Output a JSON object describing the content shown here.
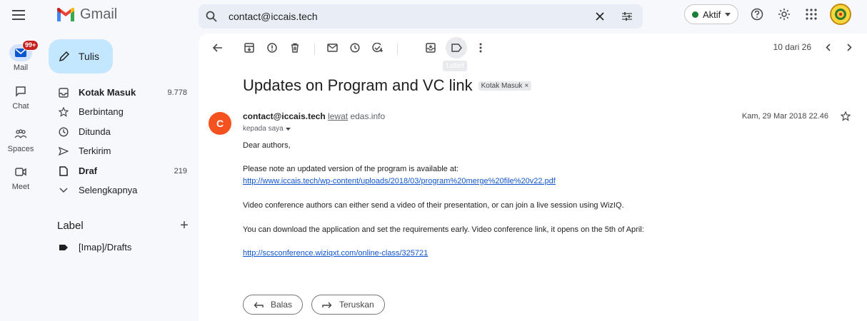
{
  "app": {
    "name": "Gmail"
  },
  "rail": {
    "items": [
      {
        "label": "Mail",
        "badge": "99+"
      },
      {
        "label": "Chat"
      },
      {
        "label": "Spaces"
      },
      {
        "label": "Meet"
      }
    ]
  },
  "sidebar": {
    "compose_label": "Tulis",
    "items": [
      {
        "label": "Kotak Masuk",
        "count": "9.778",
        "icon": "inbox-icon"
      },
      {
        "label": "Berbintang",
        "count": "",
        "icon": "star-icon"
      },
      {
        "label": "Ditunda",
        "count": "",
        "icon": "clock-icon"
      },
      {
        "label": "Terkirim",
        "count": "",
        "icon": "send-icon"
      },
      {
        "label": "Draf",
        "count": "219",
        "icon": "draft-icon"
      },
      {
        "label": "Selengkapnya",
        "count": "",
        "icon": "chevron-down-icon"
      }
    ],
    "labels_header": "Label",
    "labels": [
      {
        "label": "[Imap]/Drafts",
        "icon": "label-icon"
      }
    ]
  },
  "search": {
    "value": "contact@iccais.tech"
  },
  "status": {
    "label": "Aktif",
    "color": "#188038"
  },
  "toolbar": {
    "tooltip": "Label",
    "pager": "10 dari 26"
  },
  "email": {
    "subject": "Updates on Program and VC link",
    "chip": "Kotak Masuk",
    "chip_close": "×",
    "avatar_letter": "C",
    "sender": "contact@iccais.tech",
    "via": "lewat",
    "via_domain": "edas.info",
    "to": "kepada saya",
    "date": "Kam, 29 Mar 2018 22.46",
    "greeting": "Dear authors,",
    "line1": "Please note an updated version of the program is available at:",
    "link1": "http://www.iccais.tech/wp-content/uploads/2018/03/program%20merge%20file%20v22.pdf",
    "line2": "Video conference authors can either send a video of their presentation, or can join a live session using WizIQ.",
    "line3": "You can download the application and set the requirements early. Video conference link, it opens on the 5th of April:",
    "link2": "http://scsconference.wiziqxt.com/online-class/325721"
  },
  "actions": {
    "reply": "Balas",
    "forward": "Teruskan"
  }
}
